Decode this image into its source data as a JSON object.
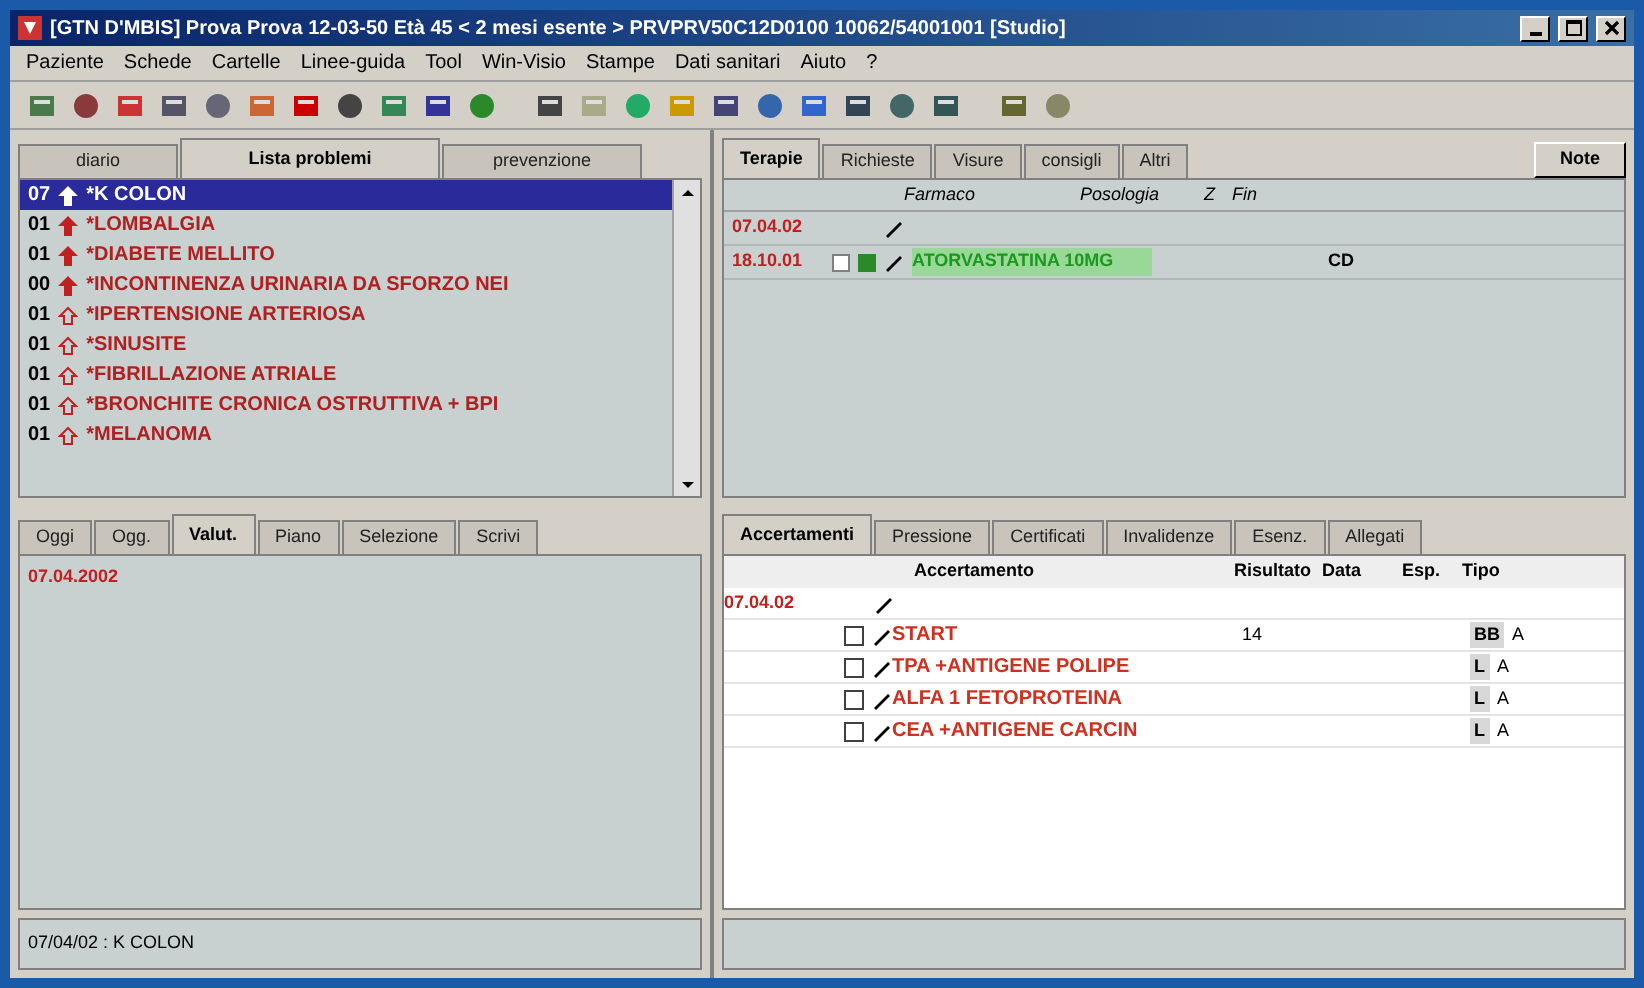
{
  "window": {
    "title": "[GTN D'MBIS] Prova Prova 12-03-50 Età 45 < 2 mesi esente > PRVPRV50C12D0100 10062/54001001 [Studio]"
  },
  "menu": [
    "Paziente",
    "Schede",
    "Cartelle",
    "Linee-guida",
    "Tool",
    "Win-Visio",
    "Stampe",
    "Dati sanitari",
    "Aiuto",
    "?"
  ],
  "problems": {
    "tabs": [
      {
        "label": "diario",
        "selected": false
      },
      {
        "label": "Lista problemi",
        "selected": true
      },
      {
        "label": "prevenzione",
        "selected": false
      }
    ],
    "rows": [
      {
        "code": "07",
        "label": "*K COLON",
        "major": true,
        "selected": true
      },
      {
        "code": "01",
        "label": "*LOMBALGIA",
        "major": true,
        "selected": false
      },
      {
        "code": "01",
        "label": "*DIABETE MELLITO",
        "major": true,
        "selected": false
      },
      {
        "code": "00",
        "label": "*INCONTINENZA URINARIA DA SFORZO NEI",
        "major": true,
        "selected": false
      },
      {
        "code": "01",
        "label": "*IPERTENSIONE ARTERIOSA",
        "major": false,
        "selected": false
      },
      {
        "code": "01",
        "label": "*SINUSITE",
        "major": false,
        "selected": false
      },
      {
        "code": "01",
        "label": "*FIBRILLAZIONE ATRIALE",
        "major": false,
        "selected": false
      },
      {
        "code": "01",
        "label": "*BRONCHITE CRONICA OSTRUTTIVA + BPI",
        "major": false,
        "selected": false
      },
      {
        "code": "01",
        "label": "*MELANOMA",
        "major": false,
        "selected": false
      }
    ]
  },
  "therapy": {
    "tabs": [
      {
        "label": "Terapie",
        "selected": true
      },
      {
        "label": "Richieste",
        "selected": false
      },
      {
        "label": "Visure",
        "selected": false
      },
      {
        "label": "consigli",
        "selected": false
      },
      {
        "label": "Altri",
        "selected": false
      }
    ],
    "note_button": "Note",
    "columns": [
      "Farmaco",
      "Posologia",
      "Z",
      "Fin"
    ],
    "rows": [
      {
        "kind": "date",
        "date": "07.04.02"
      },
      {
        "kind": "drug",
        "date": "18.10.01",
        "drug": "ATORVASTATINA 10MG",
        "fin": "CD",
        "checked": false
      }
    ]
  },
  "diary": {
    "tabs": [
      {
        "label": "Oggi",
        "selected": false
      },
      {
        "label": "Ogg.",
        "selected": false
      },
      {
        "label": "Valut.",
        "selected": true
      },
      {
        "label": "Piano",
        "selected": false
      },
      {
        "label": "Selezione",
        "selected": false
      },
      {
        "label": "Scrivi",
        "selected": false
      }
    ],
    "date": "07.04.2002"
  },
  "tests": {
    "tabs": [
      {
        "label": "Accertamenti",
        "selected": true
      },
      {
        "label": "Pressione",
        "selected": false
      },
      {
        "label": "Certificati",
        "selected": false
      },
      {
        "label": "Invalidenze",
        "selected": false
      },
      {
        "label": "Esenz.",
        "selected": false
      },
      {
        "label": "Allegati",
        "selected": false
      }
    ],
    "columns": [
      "Accertamento",
      "Risultato",
      "Data",
      "Esp.",
      "Tipo"
    ],
    "rows": [
      {
        "kind": "date",
        "date": "07.04.02"
      },
      {
        "kind": "test",
        "name": "START",
        "result": "14",
        "code": "BB",
        "type": "A",
        "checked": false
      },
      {
        "kind": "test",
        "name": "TPA +ANTIGENE POLIPE",
        "code": "L",
        "type": "A",
        "checked": false
      },
      {
        "kind": "test",
        "name": "ALFA 1 FETOPROTEINA",
        "code": "L",
        "type": "A",
        "checked": false
      },
      {
        "kind": "test",
        "name": "CEA +ANTIGENE CARCIN",
        "code": "L",
        "type": "A",
        "checked": false
      }
    ]
  },
  "status_bar": {
    "left": "07/04/02 : K COLON"
  }
}
